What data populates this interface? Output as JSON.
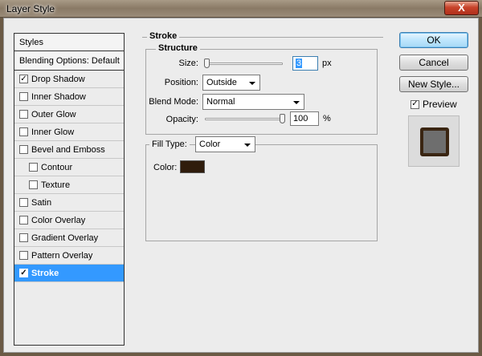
{
  "window": {
    "title": "Layer Style",
    "close_glyph": "X"
  },
  "styles_panel": {
    "header": "Styles",
    "blending_options": "Blending Options: Default",
    "items": [
      {
        "label": "Drop Shadow",
        "checked": true
      },
      {
        "label": "Inner Shadow",
        "checked": false
      },
      {
        "label": "Outer Glow",
        "checked": false
      },
      {
        "label": "Inner Glow",
        "checked": false
      },
      {
        "label": "Bevel and Emboss",
        "checked": false
      },
      {
        "label": "Contour",
        "checked": false
      },
      {
        "label": "Texture",
        "checked": false
      },
      {
        "label": "Satin",
        "checked": false
      },
      {
        "label": "Color Overlay",
        "checked": false
      },
      {
        "label": "Gradient Overlay",
        "checked": false
      },
      {
        "label": "Pattern Overlay",
        "checked": false
      },
      {
        "label": "Stroke",
        "checked": true
      }
    ]
  },
  "stroke": {
    "heading": "Stroke",
    "structure": {
      "heading": "Structure",
      "size_label": "Size:",
      "size_value": "3",
      "size_unit": "px",
      "position_label": "Position:",
      "position_value": "Outside",
      "blend_mode_label": "Blend Mode:",
      "blend_mode_value": "Normal",
      "opacity_label": "Opacity:",
      "opacity_value": "100",
      "opacity_unit": "%"
    },
    "fill": {
      "fill_type_label": "Fill Type:",
      "fill_type_value": "Color",
      "color_label": "Color:",
      "color_hex": "#2f1c0c"
    }
  },
  "buttons": {
    "ok": "OK",
    "cancel": "Cancel",
    "new_style": "New Style..."
  },
  "preview": {
    "label": "Preview",
    "checked": true
  },
  "check_glyph": "✓",
  "colors": {
    "selection": "#3399ff",
    "dialog_bg": "#ececec",
    "preview_swatch": "#6e6e6e",
    "preview_border": "#3a2512"
  }
}
